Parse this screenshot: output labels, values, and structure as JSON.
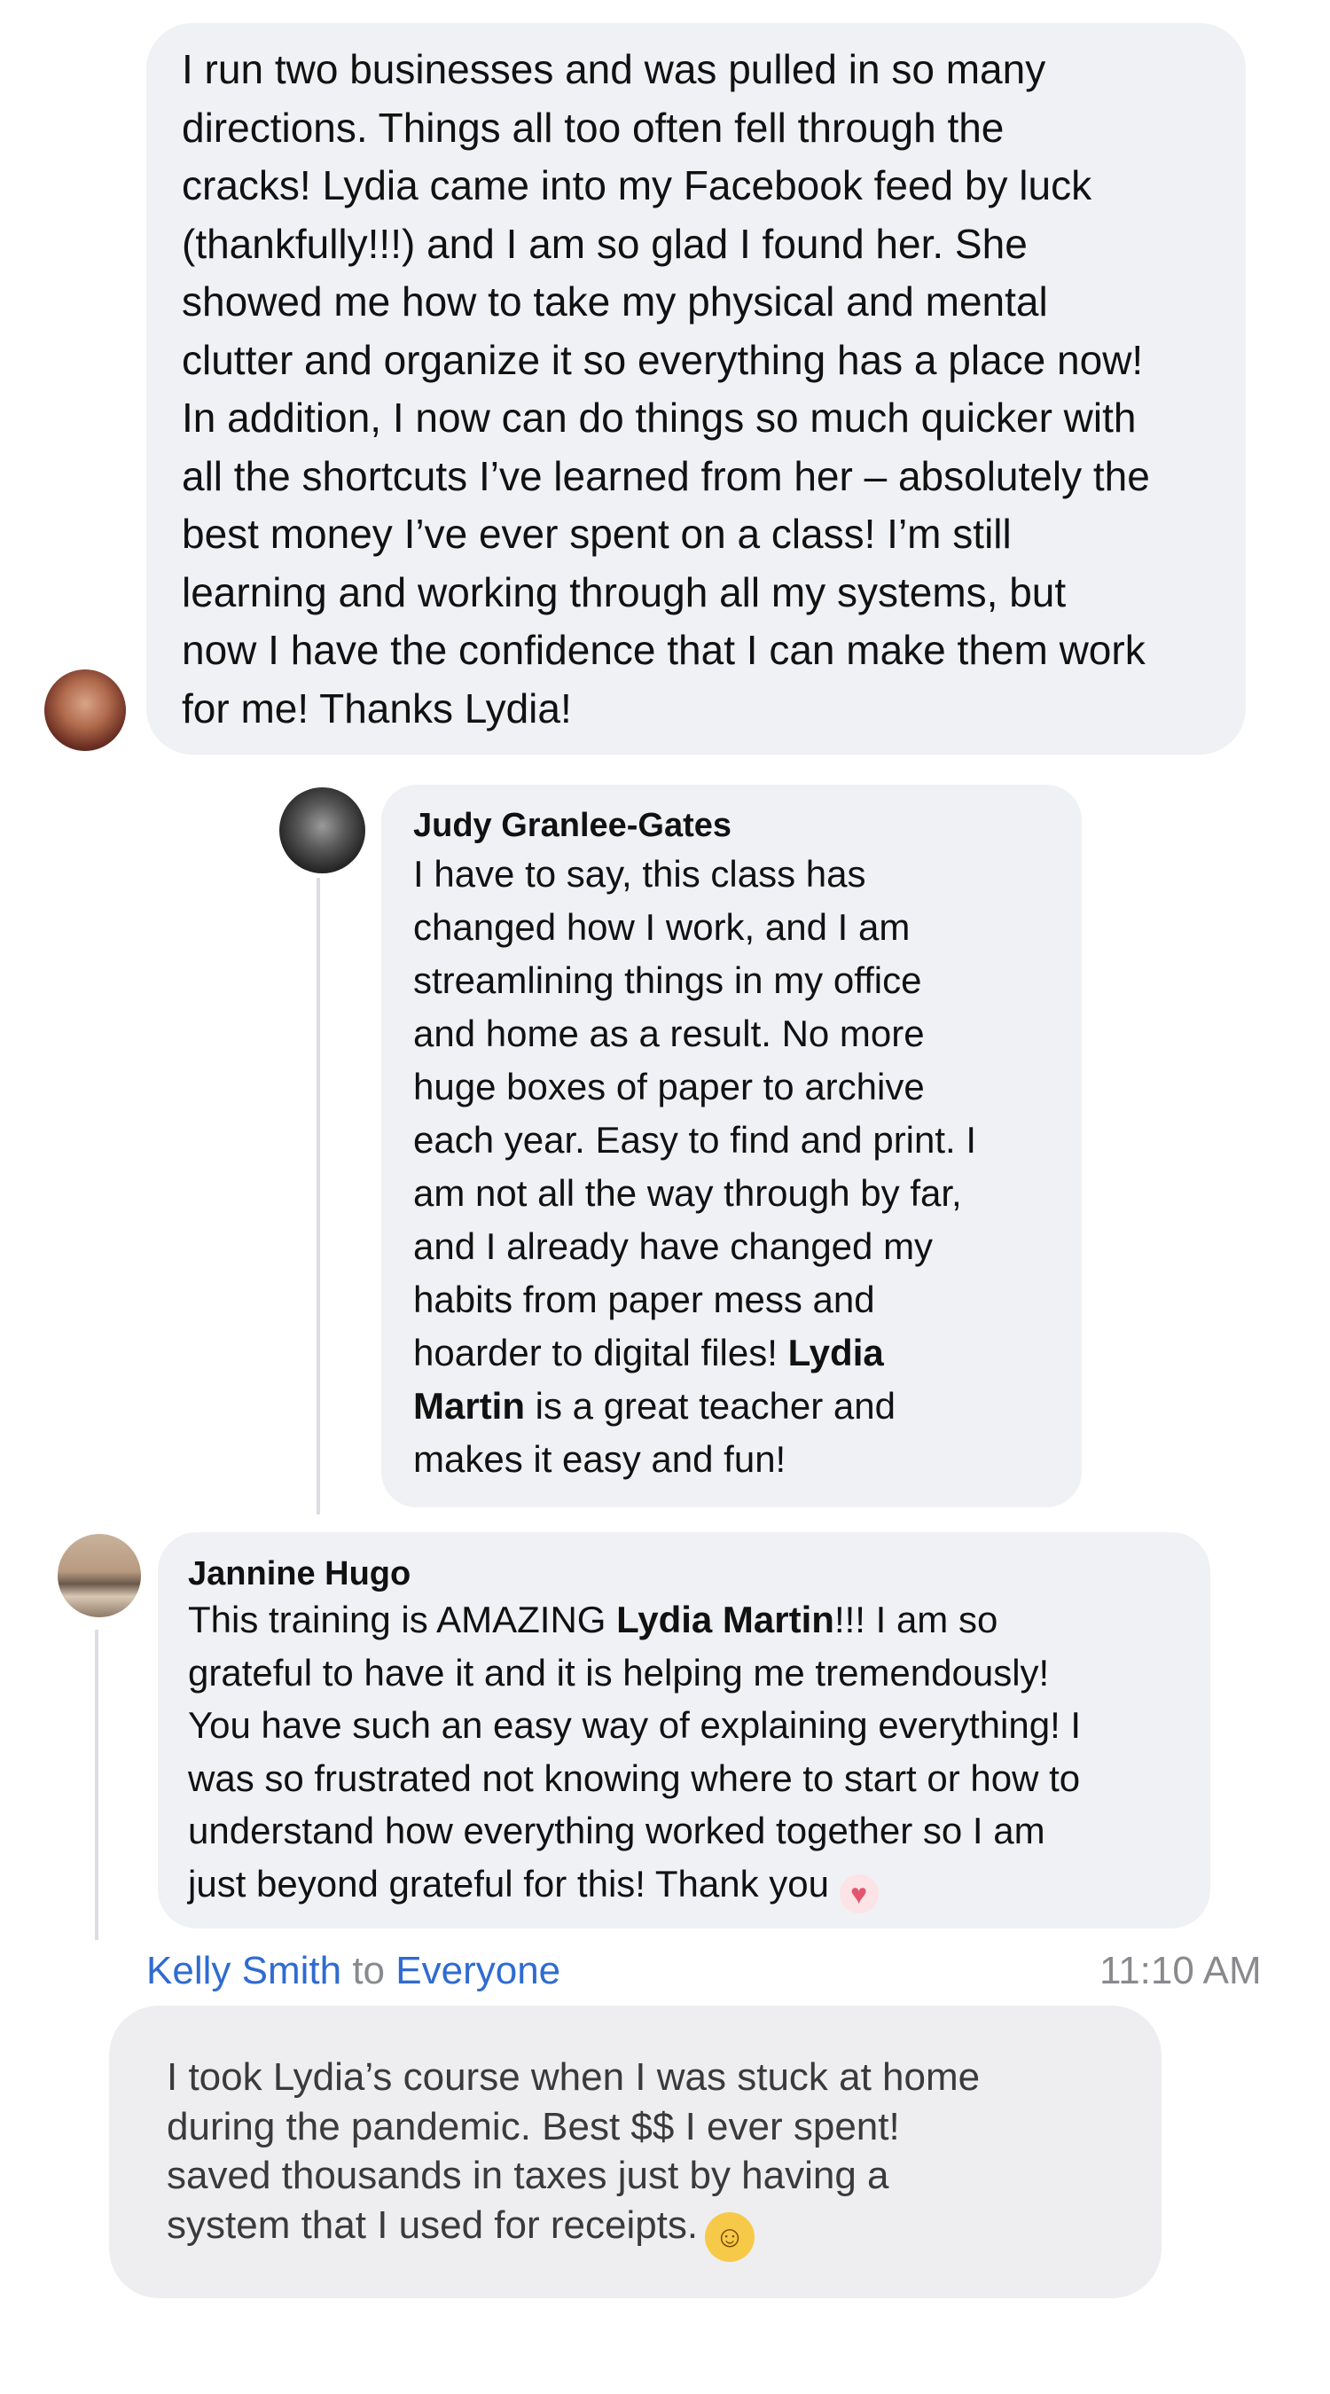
{
  "comments": [
    {
      "author": "",
      "text": "I run two businesses and was pulled in so many\ndirections.  Things all too often fell through the\ncracks!  Lydia came into my Facebook feed by luck\n(thankfully!!!) and I am so glad I found her.  She\nshowed me how to take my physical and mental\nclutter and organize it so everything has a place now!\nIn addition, I now can do things so much quicker with\nall the shortcuts I’ve learned from her – absolutely the\nbest money I’ve ever spent on a class!  I’m still\nlearning and working through all my systems, but\nnow I have the confidence that I can make them work\nfor me!  Thanks Lydia!"
    },
    {
      "author": "Judy Granlee-Gates",
      "text_before": "I have to say, this class has\nchanged how I work, and I am\nstreamlining things in my office\nand home as a result. No more\nhuge boxes of paper to archive\neach year. Easy to find and print. I\nam not all the way through by far,\nand I already have changed my\nhabits from paper mess and\nhoarder to digital files! ",
      "mention": "Lydia\nMartin",
      "text_after": " is a great teacher and\nmakes it easy and fun!"
    },
    {
      "author": "Jannine Hugo",
      "text_before": "This training is AMAZING ",
      "mention": "Lydia Martin",
      "text_after": "!!! I am so\ngrateful to have it and it is helping me tremendously!\nYou have such an easy way of explaining everything! I\nwas so frustrated not knowing where to start or how to\nunderstand how everything worked together so I am\njust beyond grateful for this! Thank you ",
      "emoji": "heart-emoji"
    }
  ],
  "chat": {
    "sender": "Kelly Smith",
    "to_word": "to",
    "recipient": "Everyone",
    "time": "11:10 AM",
    "message": "I took Lydia’s course when I was stuck at home\nduring the pandemic. Best $$ I ever spent!\nsaved thousands in taxes just by having a\nsystem that I used for receipts.",
    "emoji": "grinning-face-emoji"
  },
  "colors": {
    "bubble": "#f0f1f4",
    "link": "#2f6bd1",
    "timestamp": "#8a8a8e"
  }
}
